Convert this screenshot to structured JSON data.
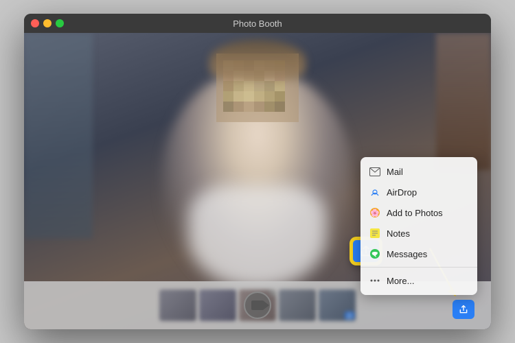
{
  "window": {
    "title": "Photo Booth"
  },
  "titlebar": {
    "close": "close",
    "minimize": "minimize",
    "maximize": "maximize"
  },
  "share_menu": {
    "items": [
      {
        "id": "mail",
        "label": "Mail",
        "icon": "✉️"
      },
      {
        "id": "airdrop",
        "label": "AirDrop",
        "icon": "📡"
      },
      {
        "id": "add-to-photos",
        "label": "Add to Photos",
        "icon": "📷"
      },
      {
        "id": "notes",
        "label": "Notes",
        "icon": "📝"
      },
      {
        "id": "messages",
        "label": "Messages",
        "icon": "💬"
      },
      {
        "id": "more",
        "label": "More...",
        "icon": "⋯"
      }
    ]
  },
  "filmstrip": {
    "delete_label": "×"
  }
}
